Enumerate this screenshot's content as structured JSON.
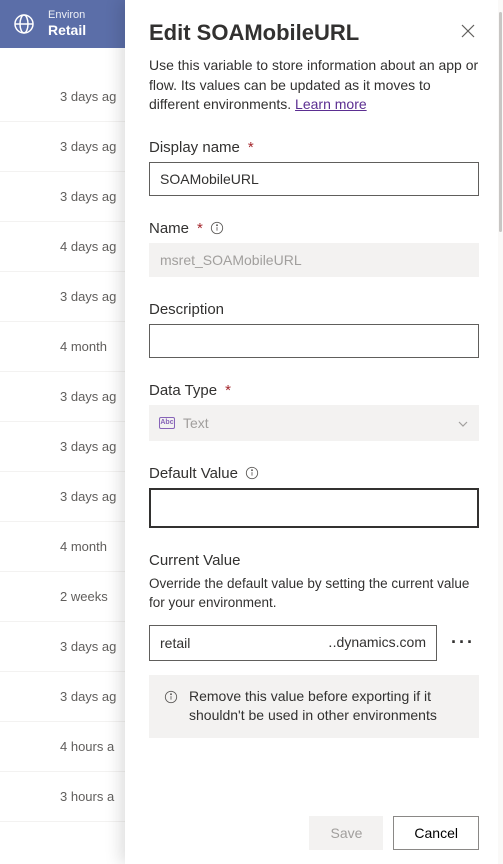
{
  "header": {
    "env_eyebrow": "Environ",
    "env_name": "Retail"
  },
  "bg_list": [
    "3 days ag",
    "3 days ag",
    "3 days ag",
    "4 days ag",
    "3 days ag",
    "4 month",
    "3 days ag",
    "3 days ag",
    "3 days ag",
    "4 month",
    "2 weeks",
    "3 days ag",
    "3 days ag",
    "4 hours a",
    "3 hours a"
  ],
  "panel": {
    "title": "Edit SOAMobileURL",
    "description_pre": "Use this variable to store information about an app or flow. Its values can be updated as it moves to different environments. ",
    "learn_more": "Learn more",
    "display_name_label": "Display name",
    "display_name_value": "SOAMobileURL",
    "name_label": "Name",
    "name_value": "msret_SOAMobileURL",
    "description_label": "Description",
    "description_value": "",
    "data_type_label": "Data Type",
    "data_type_value": "Text",
    "default_value_label": "Default Value",
    "default_value_value": "",
    "current_value_label": "Current Value",
    "current_value_help": "Override the default value by setting the current value for your environment.",
    "current_value_left": "retail",
    "current_value_right": "․.dynamics.com",
    "warning_text": "Remove this value before exporting if it shouldn't be used in other environments",
    "save_label": "Save",
    "cancel_label": "Cancel"
  }
}
